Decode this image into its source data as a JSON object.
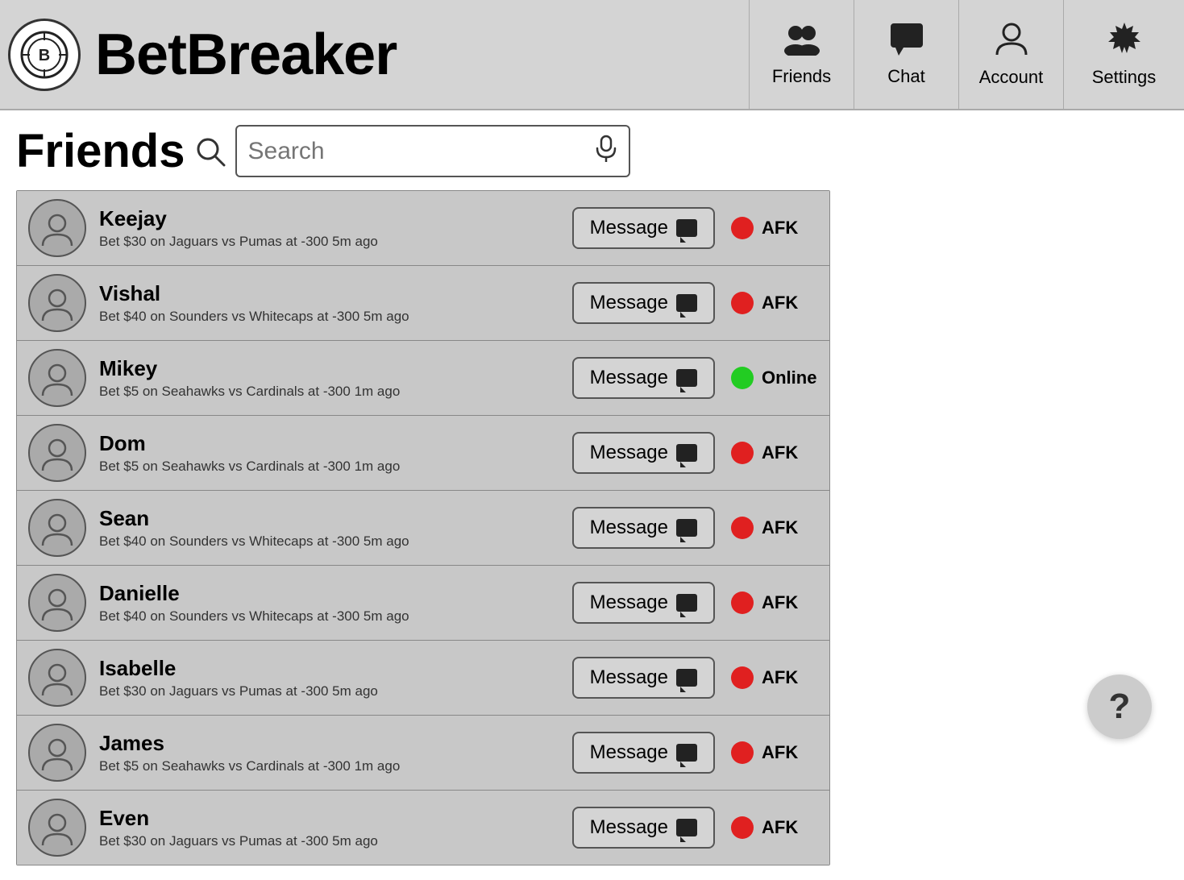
{
  "header": {
    "brand": "BetBreaker",
    "nav": [
      {
        "id": "friends",
        "label": "Friends",
        "icon": "friends"
      },
      {
        "id": "chat",
        "label": "Chat",
        "icon": "chat"
      },
      {
        "id": "account",
        "label": "Account",
        "icon": "account"
      },
      {
        "id": "settings",
        "label": "Settings",
        "icon": "settings"
      }
    ]
  },
  "page": {
    "title": "Friends",
    "search": {
      "placeholder": "Search"
    }
  },
  "friends": [
    {
      "name": "Keejay",
      "bet": "Bet $30 on Jaguars vs Pumas at -300 5m ago",
      "status": "afk",
      "statusLabel": "AFK",
      "messageLabel": "Message"
    },
    {
      "name": "Vishal",
      "bet": "Bet $40 on Sounders vs Whitecaps at -300 5m ago",
      "status": "afk",
      "statusLabel": "AFK",
      "messageLabel": "Message"
    },
    {
      "name": "Mikey",
      "bet": "Bet $5 on Seahawks vs Cardinals at -300 1m ago",
      "status": "online",
      "statusLabel": "Online",
      "messageLabel": "Message"
    },
    {
      "name": "Dom",
      "bet": "Bet $5 on Seahawks vs Cardinals at -300 1m ago",
      "status": "afk",
      "statusLabel": "AFK",
      "messageLabel": "Message"
    },
    {
      "name": "Sean",
      "bet": "Bet $40 on Sounders vs Whitecaps at -300 5m ago",
      "status": "afk",
      "statusLabel": "AFK",
      "messageLabel": "Message"
    },
    {
      "name": "Danielle",
      "bet": "Bet $40 on Sounders vs Whitecaps at -300 5m ago",
      "status": "afk",
      "statusLabel": "AFK",
      "messageLabel": "Message"
    },
    {
      "name": "Isabelle",
      "bet": "Bet $30 on Jaguars vs Pumas at -300 5m ago",
      "status": "afk",
      "statusLabel": "AFK",
      "messageLabel": "Message"
    },
    {
      "name": "James",
      "bet": "Bet $5 on Seahawks vs Cardinals at -300 1m ago",
      "status": "afk",
      "statusLabel": "AFK",
      "messageLabel": "Message"
    },
    {
      "name": "Even",
      "bet": "Bet $30 on Jaguars vs Pumas at -300 5m ago",
      "status": "afk",
      "statusLabel": "AFK",
      "messageLabel": "Message"
    }
  ],
  "help": {
    "label": "?"
  }
}
